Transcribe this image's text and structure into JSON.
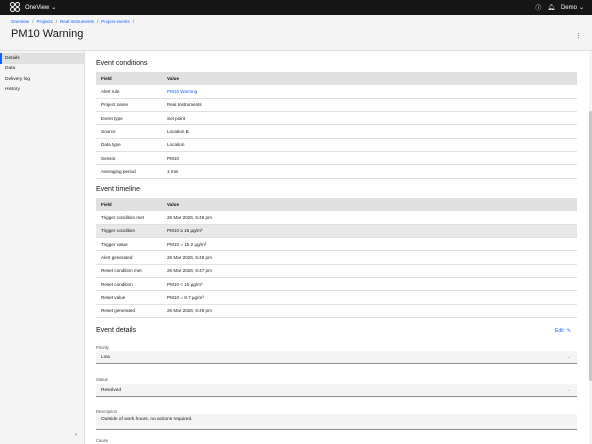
{
  "app": {
    "name": "OneView"
  },
  "topbar": {
    "user": "Demo"
  },
  "breadcrumb": [
    "OneView",
    "Projects",
    "Real Instruments",
    "Project events"
  ],
  "page": {
    "title": "PM10 Warning"
  },
  "sidebar": {
    "items": [
      "Details",
      "Data",
      "Delivery log",
      "History"
    ]
  },
  "conditions": {
    "title": "Event conditions",
    "headers": [
      "Field",
      "Value"
    ],
    "rows": [
      [
        "Alert rule",
        "PM10 Warning"
      ],
      [
        "Project name",
        "Real Instruments"
      ],
      [
        "Event type",
        "Set point"
      ],
      [
        "Source",
        "Location B"
      ],
      [
        "Data type",
        "Location"
      ],
      [
        "Sensor",
        "PM10"
      ],
      [
        "Averaging period",
        "1 min"
      ]
    ]
  },
  "timeline": {
    "title": "Event timeline",
    "headers": [
      "Field",
      "Value"
    ],
    "rows": [
      [
        "Trigger condition met",
        "26 Mar 2026, 5:46 pm"
      ],
      [
        "Trigger condition",
        "PM10 ≥ 15 µg/m³"
      ],
      [
        "Trigger value",
        "PM10 = 15.2 µg/m³"
      ],
      [
        "Alert generated",
        "26 Mar 2026, 5:48 pm"
      ],
      [
        "Reset condition met",
        "26 Mar 2026, 6:47 pm"
      ],
      [
        "Reset condition",
        "PM10 < 10 µg/m³"
      ],
      [
        "Reset value",
        "PM10 = 9.7 µg/m³"
      ],
      [
        "Reset generated",
        "26 Mar 2026, 6:49 pm"
      ]
    ]
  },
  "details": {
    "title": "Event details",
    "edit_label": "Edit",
    "priority_label": "Priority",
    "priority_value": "Low",
    "status_label": "Status",
    "status_value": "Resolved",
    "description_label": "Description",
    "description_value": "Outside of work hours, no actions required.",
    "cause_label": "Cause"
  }
}
